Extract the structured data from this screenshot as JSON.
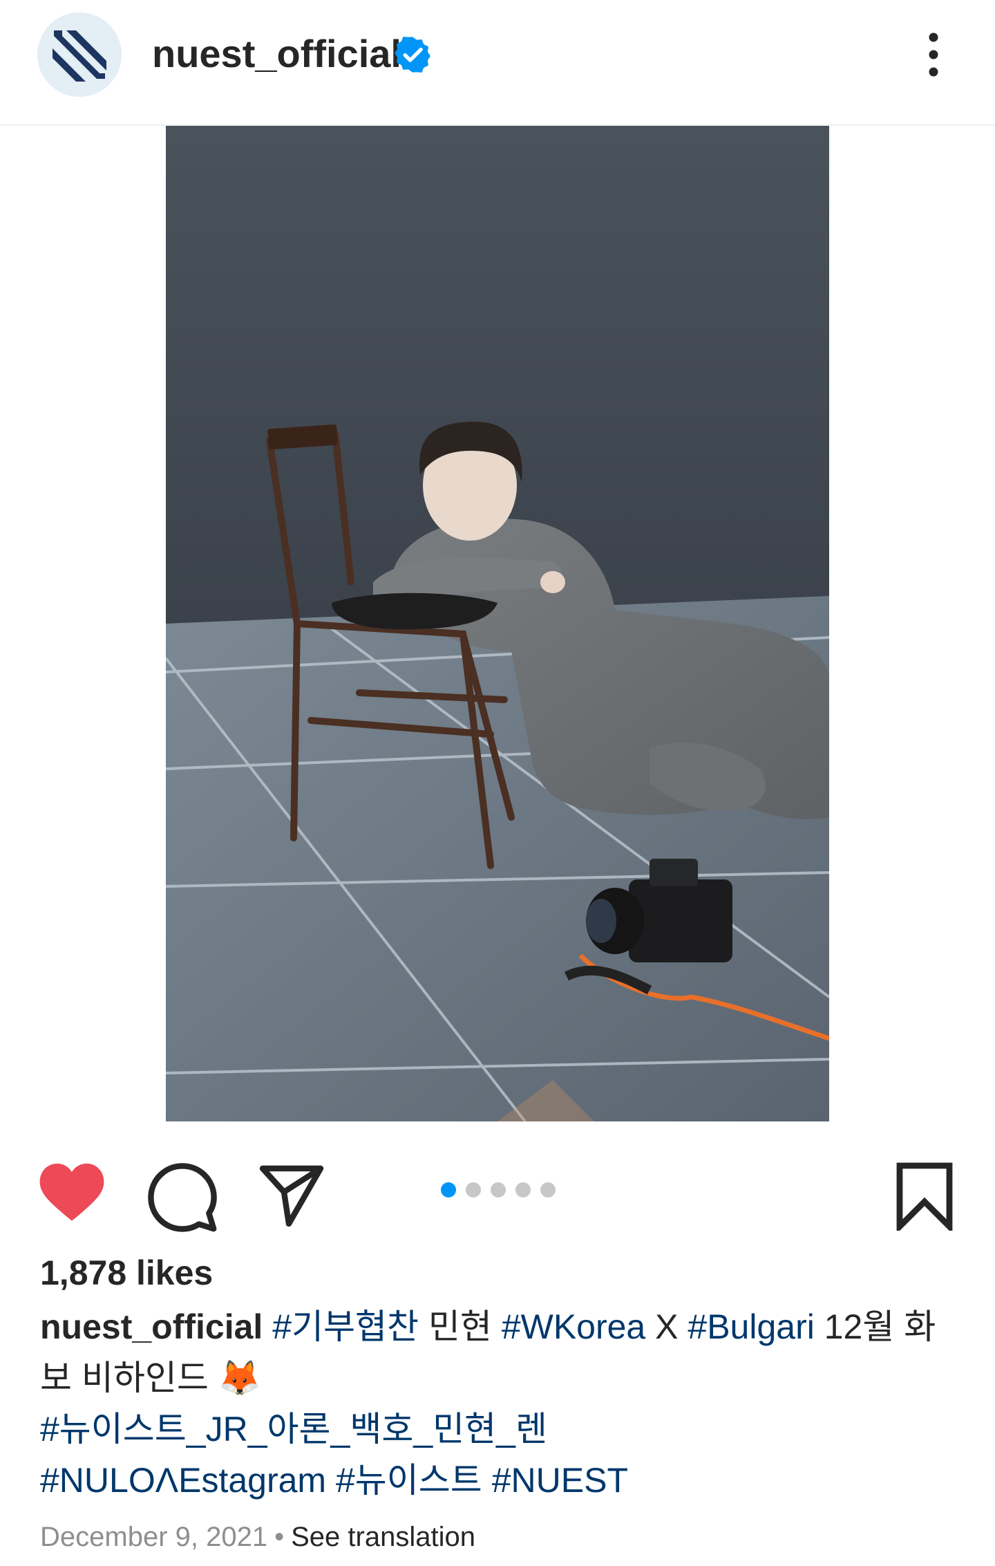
{
  "post": {
    "username": "nuest_official",
    "verified": true,
    "likes_text": "1,878 likes",
    "liked": true,
    "carousel": {
      "total": 5,
      "active_index": 0
    },
    "caption": {
      "username": "nuest_official",
      "tag_1": "#기부협찬",
      "text_1": " 민현 ",
      "tag_2": "#WKorea",
      "text_2": " X ",
      "tag_3": "#Bulgari",
      "text_3": " 12월 화보 비하인드 🦊",
      "tag_4": "#뉴이스트_JR_아론_백호_민현_렌",
      "tag_5": "#NULOΛEstagram",
      "tag_6": "#뉴이스트",
      "tag_7": "#NUEST"
    },
    "date": "December 9, 2021",
    "separator": "•",
    "see_translation": "See translation"
  },
  "icons": {
    "avatar": "nuest-logo",
    "verified": "verified-badge-icon",
    "more": "more-vertical-icon",
    "like": "heart-icon",
    "comment": "comment-icon",
    "share": "paper-plane-icon",
    "save": "bookmark-icon"
  },
  "colors": {
    "heart": "#ed4956",
    "verified": "#0095f6",
    "active_dot": "#0095f6",
    "hashtag": "#00376b",
    "muted": "#8e8e8e"
  }
}
